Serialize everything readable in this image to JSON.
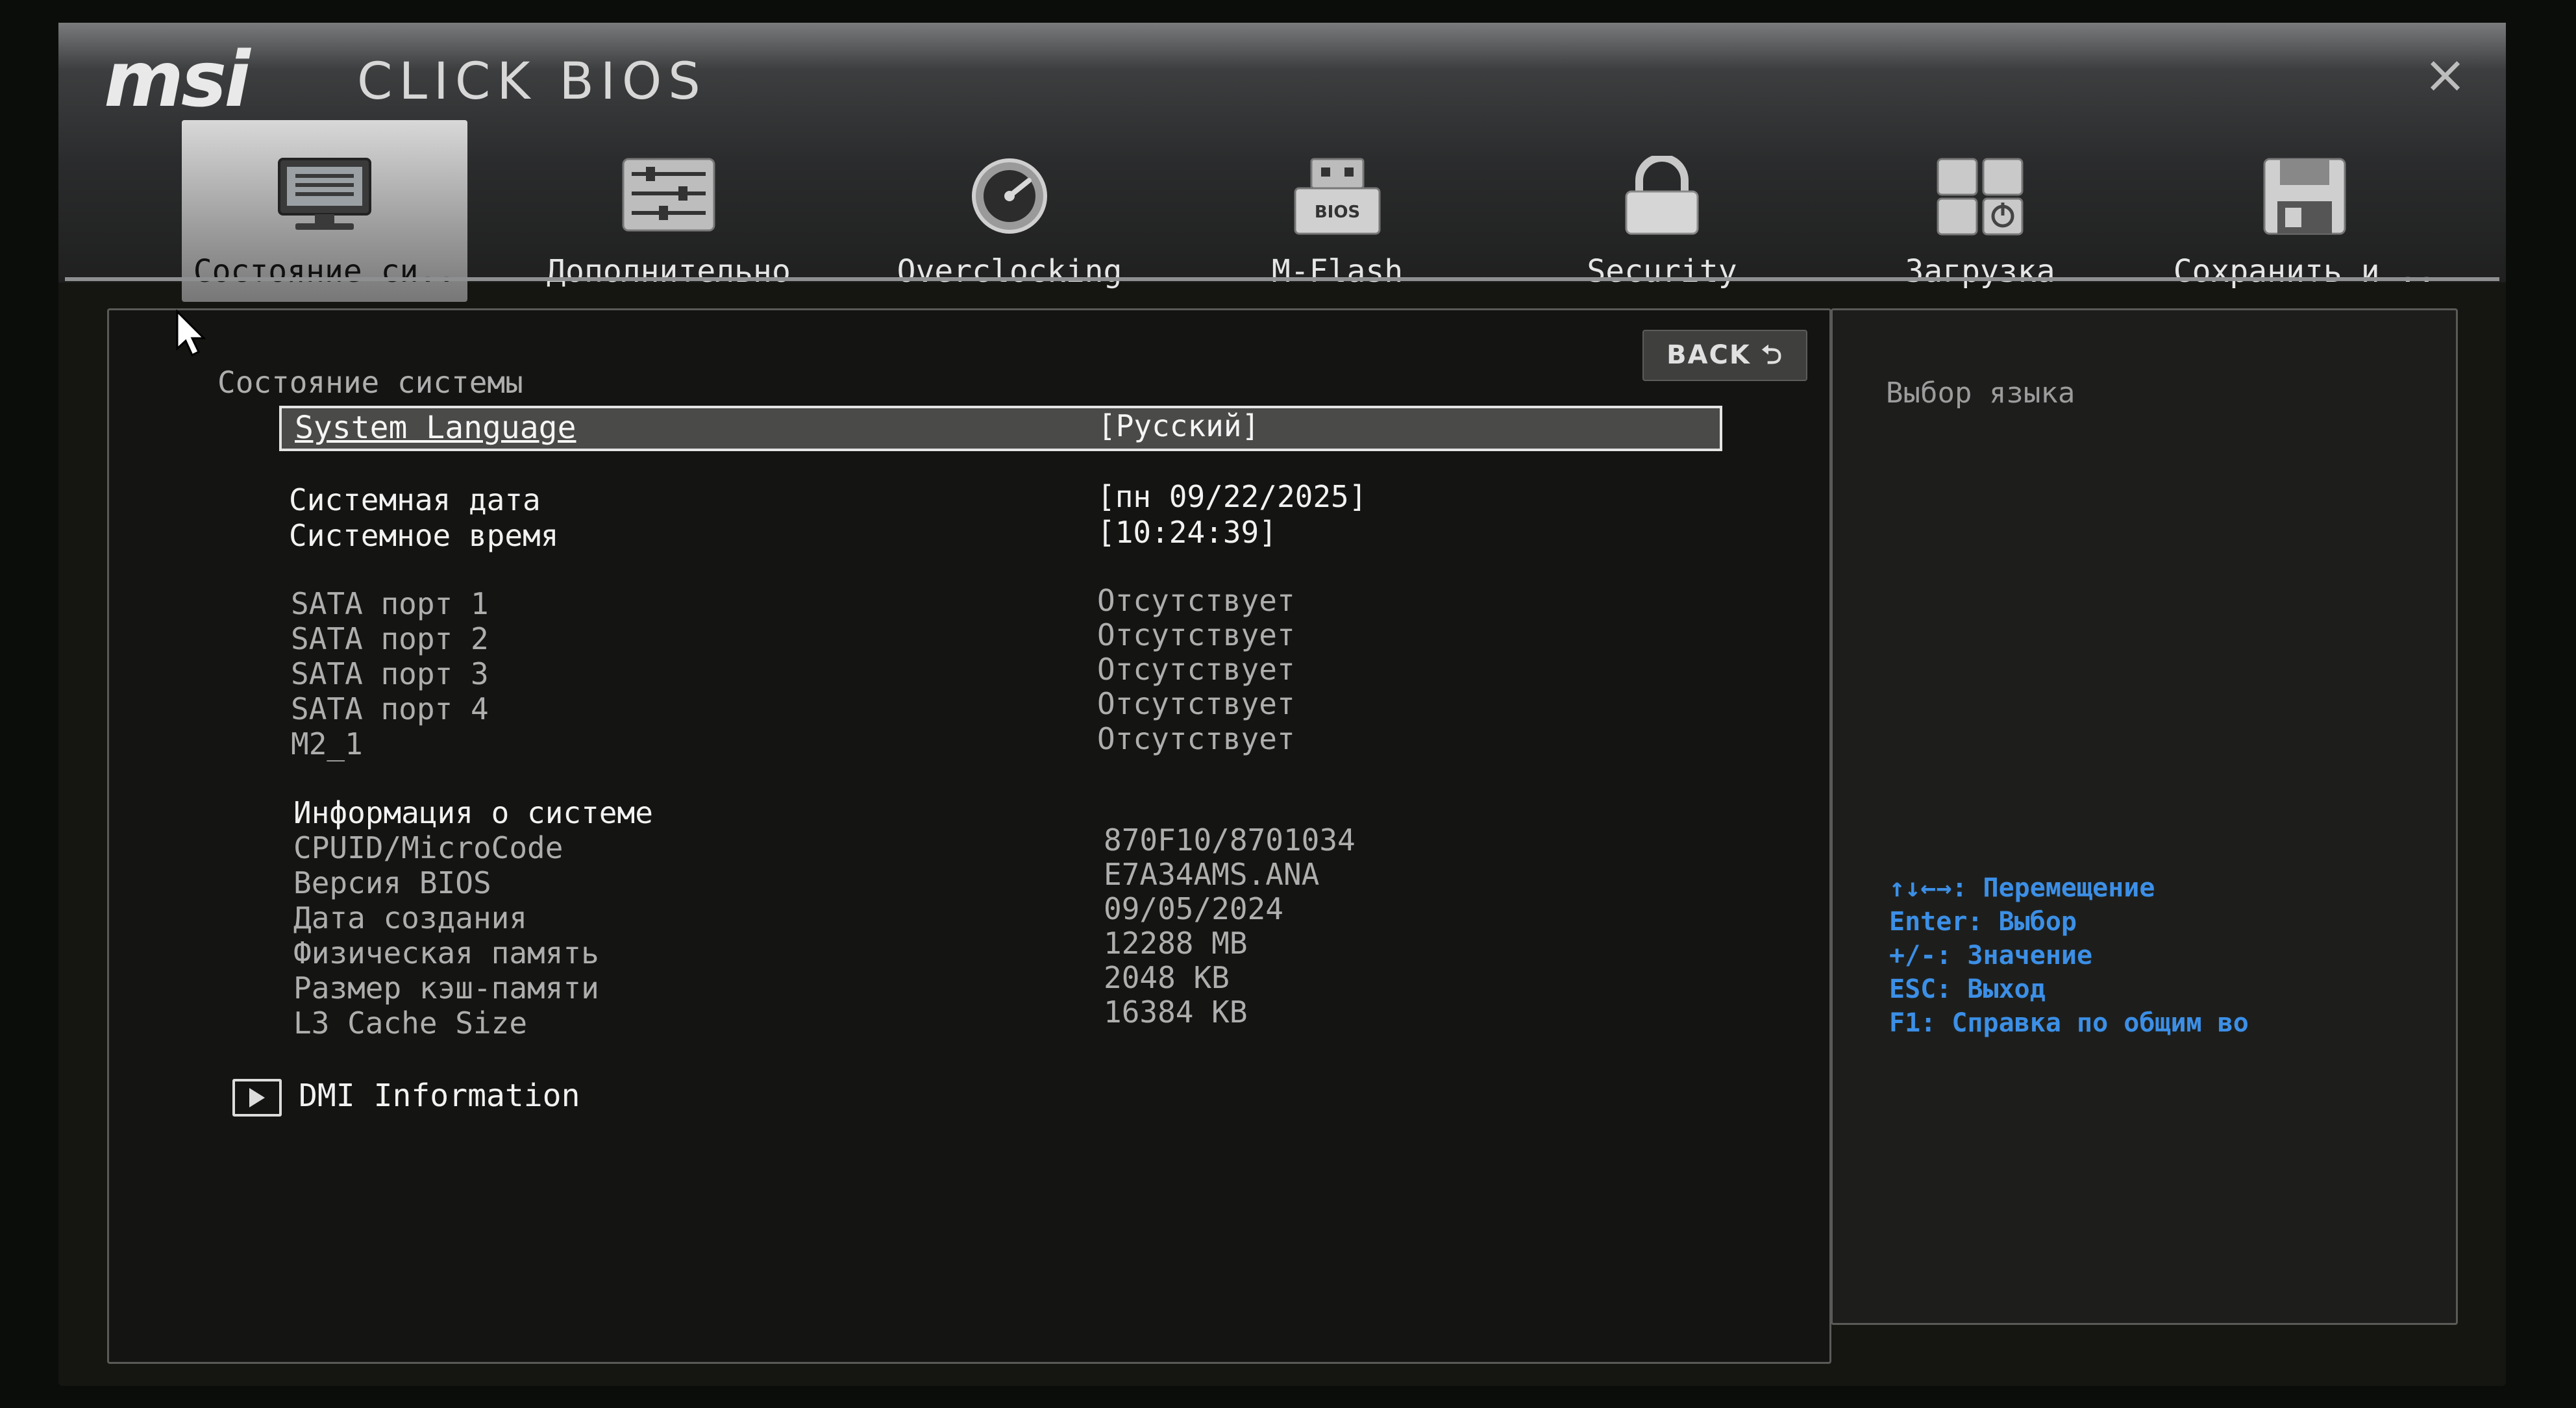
{
  "header": {
    "logo": "msi",
    "product": "CLICK BIOS",
    "close_symbol": "×"
  },
  "tabs": [
    {
      "label": "Состояние си..",
      "icon": "monitor-icon",
      "active": true
    },
    {
      "label": "Дополнительно",
      "icon": "sliders-icon",
      "active": false
    },
    {
      "label": "Overclocking",
      "icon": "gauge-icon",
      "active": false
    },
    {
      "label": "M-Flash",
      "icon": "usb-bios-icon",
      "active": false
    },
    {
      "label": "Security",
      "icon": "lock-icon",
      "active": false
    },
    {
      "label": "Загрузка",
      "icon": "boot-icon",
      "active": false
    },
    {
      "label": "Сохранить и ..",
      "icon": "floppy-icon",
      "active": false
    }
  ],
  "main": {
    "back_label": "BACK ⮌",
    "section_title": "Состояние системы",
    "language": {
      "label": "System Language",
      "value": "[Русский]"
    },
    "date": {
      "label": "Системная дата",
      "value": "[пн 09/22/2025]"
    },
    "time": {
      "label": "Системное время",
      "value": "[10:24:39]"
    },
    "ports": [
      {
        "label": "SATA порт 1",
        "value": "Отсутствует"
      },
      {
        "label": "SATA порт 2",
        "value": "Отсутствует"
      },
      {
        "label": "SATA порт 3",
        "value": "Отсутствует"
      },
      {
        "label": "SATA порт 4",
        "value": "Отсутствует"
      },
      {
        "label": "M2_1",
        "value": "Отсутствует"
      }
    ],
    "sysinfo_heading": "Информация о системе",
    "sysinfo": [
      {
        "label": "CPUID/MicroCode",
        "value": "870F10/8701034"
      },
      {
        "label": "Версия BIOS",
        "value": "E7A34AMS.ANA"
      },
      {
        "label": "Дата создания",
        "value": "09/05/2024"
      },
      {
        "label": "Физическая память",
        "value": "12288 MB"
      },
      {
        "label": "Размер кэш-памяти",
        "value": "2048 KB"
      },
      {
        "label": "L3 Cache Size",
        "value": "16384 KB"
      }
    ],
    "dmi_label": "DMI Information"
  },
  "help": {
    "title": "Выбор языка",
    "hints": [
      "↑↓←→: Перемещение",
      "Enter: Выбор",
      "+/-: Значение",
      "ESC: Выход",
      "F1: Справка по общим во"
    ]
  },
  "colors": {
    "hint_blue": "#3c8fe6",
    "background": "#151612",
    "header_gray": "#3d3e3f"
  }
}
